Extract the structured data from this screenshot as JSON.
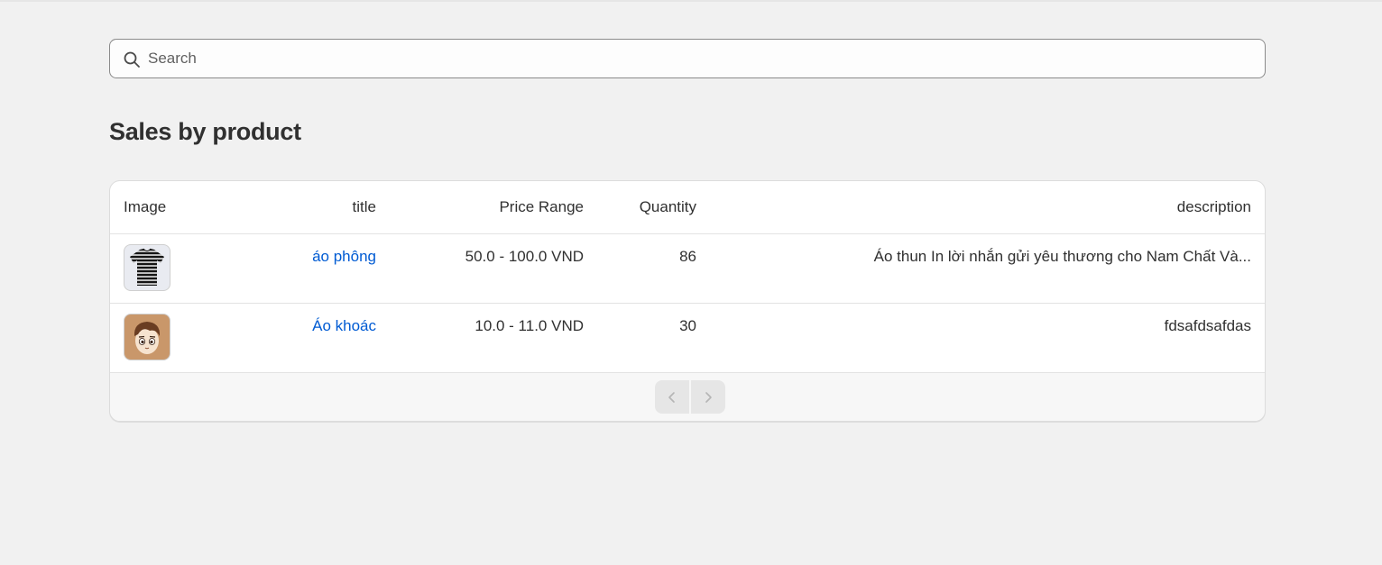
{
  "search": {
    "placeholder": "Search",
    "value": ""
  },
  "page": {
    "title": "Sales by product"
  },
  "table": {
    "headers": {
      "image": "Image",
      "title": "title",
      "price_range": "Price Range",
      "quantity": "Quantity",
      "description": "description"
    },
    "rows": [
      {
        "title": "áo phông",
        "price_range": "50.0 - 100.0 VND",
        "quantity": "86",
        "description": "Áo thun In lời nhắn gửi yêu thương cho Nam Chất Và..."
      },
      {
        "title": "Áo khoác",
        "price_range": "10.0 - 11.0 VND",
        "quantity": "30",
        "description": "fdsafdsafdas"
      }
    ]
  },
  "pagination": {
    "prev_icon": "chevron-left-icon",
    "next_icon": "chevron-right-icon"
  },
  "colors": {
    "background": "#f1f1f1",
    "link": "#005bd3",
    "text": "#303030"
  }
}
